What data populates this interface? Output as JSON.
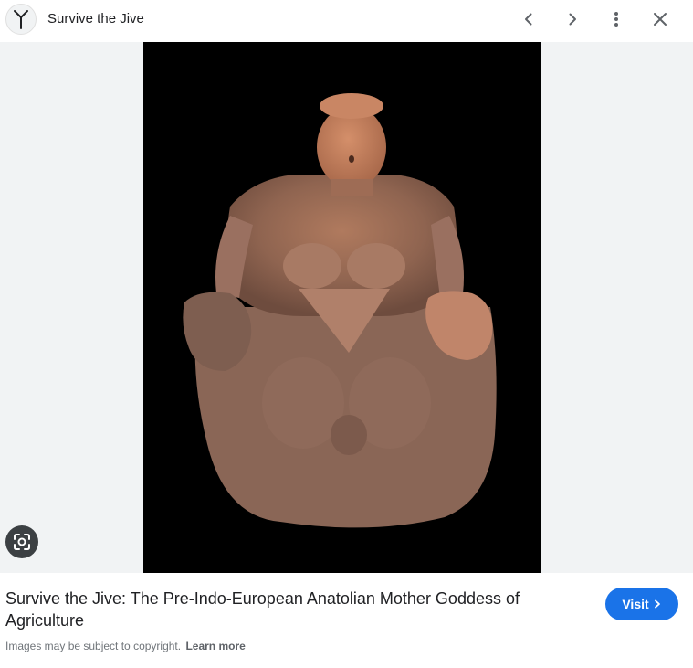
{
  "header": {
    "site_name": "Survive the Jive",
    "favicon_icon": "trident-icon",
    "prev_icon": "chevron-left-icon",
    "next_icon": "chevron-right-icon",
    "more_icon": "more-vert-icon",
    "close_icon": "close-icon"
  },
  "image": {
    "background_color": "#000000",
    "panel_color": "#f1f3f4",
    "lens_icon": "google-lens-icon"
  },
  "caption": {
    "title": "Survive the Jive: The Pre-Indo-European Anatolian Mother Goddess of Agriculture",
    "visit_label": "Visit",
    "visit_icon": "chevron-right-icon",
    "copyright_text": "Images may be subject to copyright.",
    "learn_more": "Learn more",
    "accent_color": "#1a73e8"
  }
}
